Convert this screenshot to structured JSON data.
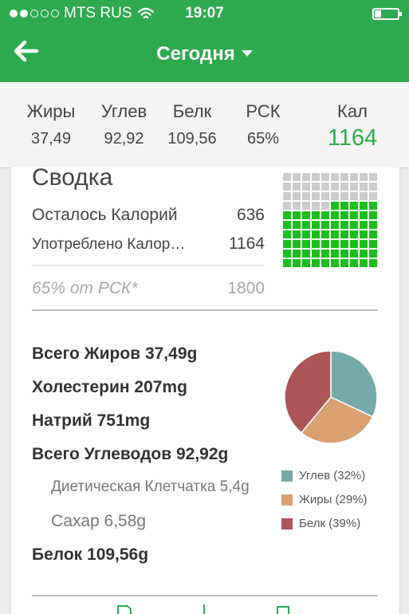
{
  "status_bar": {
    "carrier": "MTS RUS",
    "time": "19:07",
    "signal_dots": [
      true,
      true,
      false,
      false,
      false
    ]
  },
  "nav": {
    "title": "Сегодня"
  },
  "macros": {
    "fat": {
      "label": "Жиры",
      "value": "37,49"
    },
    "carbs": {
      "label": "Углев",
      "value": "92,92"
    },
    "protein": {
      "label": "Белк",
      "value": "109,56"
    },
    "rdi": {
      "label": "РСК",
      "value": "65%"
    },
    "cal": {
      "label": "Кал",
      "value": "1164"
    }
  },
  "summary": {
    "title": "Сводка",
    "remaining_label": "Осталось Калорий",
    "remaining_value": "636",
    "consumed_label": "Употреблено Калор…",
    "consumed_value": "1164",
    "rdi_label": "65% от РСК*",
    "rdi_value": "1800",
    "waffle": {
      "filled_fraction": 0.65,
      "filled_color": "#1bbf1b",
      "empty_color": "#cccccc"
    }
  },
  "nutrition": {
    "total_fat": "Всего Жиров 37,49g",
    "cholesterol": "Холестерин 207mg",
    "sodium": "Натрий 751mg",
    "total_carbs": "Всего Углеводов 92,92g",
    "fiber": "Диетическая Клетчатка 5,4g",
    "sugar": "Сахар 6,58g",
    "protein": "Белок 109,56g"
  },
  "pie": {
    "slices": [
      {
        "name": "Углев",
        "percent": 32,
        "color": "#75a9a7"
      },
      {
        "name": "Жиры",
        "percent": 29,
        "color": "#dba071"
      },
      {
        "name": "Белк",
        "percent": 39,
        "color": "#ac5559"
      }
    ],
    "legend": [
      {
        "label": "Углев (32%)",
        "color": "#75a9a7"
      },
      {
        "label": "Жиры (29%)",
        "color": "#dba071"
      },
      {
        "label": "Белк (39%)",
        "color": "#ac5559"
      }
    ]
  },
  "colors": {
    "brand_green": "#2eaa4e",
    "calorie_green": "#2eaa4e"
  }
}
